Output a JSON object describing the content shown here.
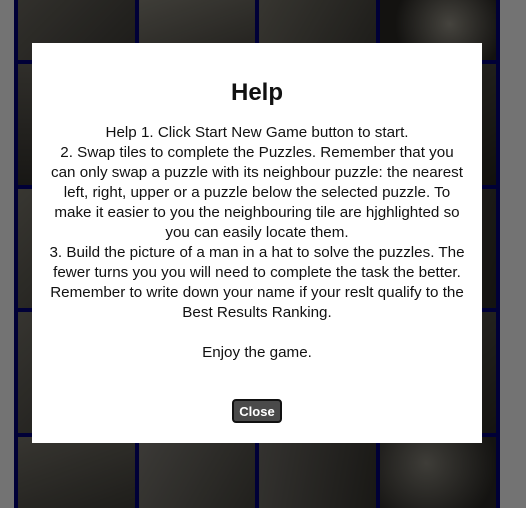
{
  "modal": {
    "title": "Help",
    "lines": [
      "Help 1. Click Start New Game button to start.",
      "2. Swap tiles to complete the Puzzles. Remember that you can only swap a puzzle with its neighbour puzzle: the nearest left, right, upper or a puzzle below the selected puzzle. To make it easier to you the neighbouring tile are hjghlighted so you can easily locate them.",
      "3. Build the picture of a man in a hat to solve the puzzles. The fewer turns you you will need to complete the task the better. Remember to write down your name if your reslt qualify to the Best Results Ranking."
    ],
    "enjoy": "Enjoy the game.",
    "close_label": "Close"
  },
  "colors": {
    "board_grid": "#00007a",
    "overlay": "rgba(0,0,0,0.55)",
    "button_bg": "#4a4a4a"
  }
}
